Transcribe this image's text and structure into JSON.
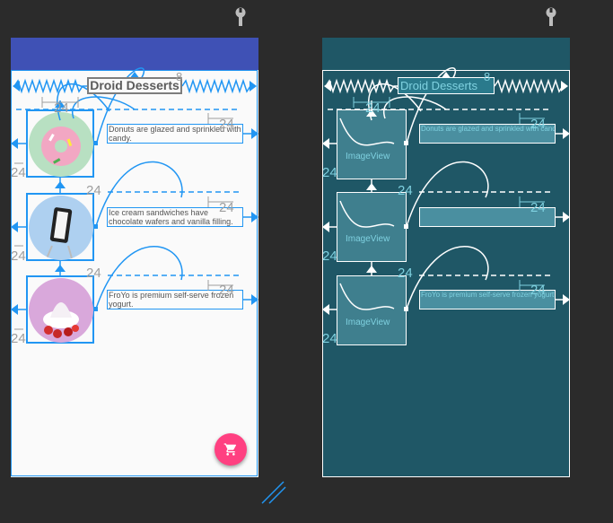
{
  "app": {
    "title": "Droid Desserts"
  },
  "items": [
    {
      "description": "Donuts are glazed and sprinkled with candy.",
      "blueprint_description": "Donuts are glazed and sprinkled with candy."
    },
    {
      "description": "Ice cream sandwiches have chocolate wafers and vanilla filling.",
      "blueprint_description": ""
    },
    {
      "description": "FroYo is premium self-serve frozen yogurt.",
      "blueprint_description": "FroYo is premium self-serve frozen yogurt."
    }
  ],
  "blueprint": {
    "image_label": "ImageView"
  },
  "margins": {
    "value": "24",
    "small": "8"
  },
  "icons": {
    "pin": "wrench-icon",
    "fab": "shopping-cart-icon",
    "resize": "resize-handle-icon"
  },
  "colors": {
    "appbar": "#3f51b5",
    "constraint": "#2196f3",
    "fab": "#ff4081",
    "blueprint_bg": "#1f5766",
    "canvas_bg": "#2b2b2b"
  }
}
